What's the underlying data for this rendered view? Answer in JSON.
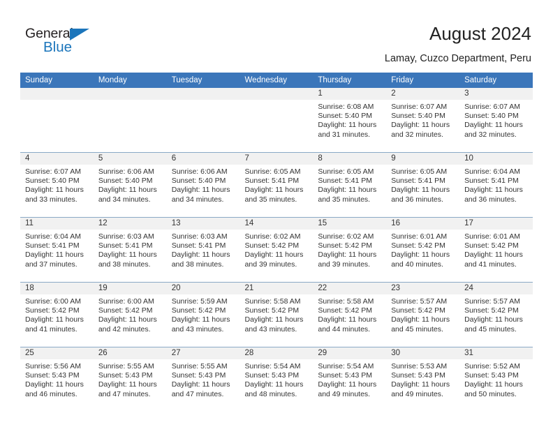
{
  "brand": {
    "name_part1": "General",
    "name_part2": "Blue",
    "triangle_icon": "triangle-icon",
    "color_primary": "#1b75bb",
    "color_text": "#231f20"
  },
  "header": {
    "title": "August 2024",
    "subtitle": "Lamay, Cuzco Department, Peru"
  },
  "theme": {
    "header_bg": "#3b76ba",
    "header_text": "#ffffff",
    "daynum_band_bg": "#f1f1f1",
    "row_divider": "#8aa9c6"
  },
  "weekday_headers": [
    "Sunday",
    "Monday",
    "Tuesday",
    "Wednesday",
    "Thursday",
    "Friday",
    "Saturday"
  ],
  "weeks": [
    [
      {
        "day": "",
        "sunrise": "",
        "sunset": "",
        "daylight1": "",
        "daylight2": ""
      },
      {
        "day": "",
        "sunrise": "",
        "sunset": "",
        "daylight1": "",
        "daylight2": ""
      },
      {
        "day": "",
        "sunrise": "",
        "sunset": "",
        "daylight1": "",
        "daylight2": ""
      },
      {
        "day": "",
        "sunrise": "",
        "sunset": "",
        "daylight1": "",
        "daylight2": ""
      },
      {
        "day": "1",
        "sunrise": "Sunrise: 6:08 AM",
        "sunset": "Sunset: 5:40 PM",
        "daylight1": "Daylight: 11 hours",
        "daylight2": "and 31 minutes."
      },
      {
        "day": "2",
        "sunrise": "Sunrise: 6:07 AM",
        "sunset": "Sunset: 5:40 PM",
        "daylight1": "Daylight: 11 hours",
        "daylight2": "and 32 minutes."
      },
      {
        "day": "3",
        "sunrise": "Sunrise: 6:07 AM",
        "sunset": "Sunset: 5:40 PM",
        "daylight1": "Daylight: 11 hours",
        "daylight2": "and 32 minutes."
      }
    ],
    [
      {
        "day": "4",
        "sunrise": "Sunrise: 6:07 AM",
        "sunset": "Sunset: 5:40 PM",
        "daylight1": "Daylight: 11 hours",
        "daylight2": "and 33 minutes."
      },
      {
        "day": "5",
        "sunrise": "Sunrise: 6:06 AM",
        "sunset": "Sunset: 5:40 PM",
        "daylight1": "Daylight: 11 hours",
        "daylight2": "and 34 minutes."
      },
      {
        "day": "6",
        "sunrise": "Sunrise: 6:06 AM",
        "sunset": "Sunset: 5:40 PM",
        "daylight1": "Daylight: 11 hours",
        "daylight2": "and 34 minutes."
      },
      {
        "day": "7",
        "sunrise": "Sunrise: 6:05 AM",
        "sunset": "Sunset: 5:41 PM",
        "daylight1": "Daylight: 11 hours",
        "daylight2": "and 35 minutes."
      },
      {
        "day": "8",
        "sunrise": "Sunrise: 6:05 AM",
        "sunset": "Sunset: 5:41 PM",
        "daylight1": "Daylight: 11 hours",
        "daylight2": "and 35 minutes."
      },
      {
        "day": "9",
        "sunrise": "Sunrise: 6:05 AM",
        "sunset": "Sunset: 5:41 PM",
        "daylight1": "Daylight: 11 hours",
        "daylight2": "and 36 minutes."
      },
      {
        "day": "10",
        "sunrise": "Sunrise: 6:04 AM",
        "sunset": "Sunset: 5:41 PM",
        "daylight1": "Daylight: 11 hours",
        "daylight2": "and 36 minutes."
      }
    ],
    [
      {
        "day": "11",
        "sunrise": "Sunrise: 6:04 AM",
        "sunset": "Sunset: 5:41 PM",
        "daylight1": "Daylight: 11 hours",
        "daylight2": "and 37 minutes."
      },
      {
        "day": "12",
        "sunrise": "Sunrise: 6:03 AM",
        "sunset": "Sunset: 5:41 PM",
        "daylight1": "Daylight: 11 hours",
        "daylight2": "and 38 minutes."
      },
      {
        "day": "13",
        "sunrise": "Sunrise: 6:03 AM",
        "sunset": "Sunset: 5:41 PM",
        "daylight1": "Daylight: 11 hours",
        "daylight2": "and 38 minutes."
      },
      {
        "day": "14",
        "sunrise": "Sunrise: 6:02 AM",
        "sunset": "Sunset: 5:42 PM",
        "daylight1": "Daylight: 11 hours",
        "daylight2": "and 39 minutes."
      },
      {
        "day": "15",
        "sunrise": "Sunrise: 6:02 AM",
        "sunset": "Sunset: 5:42 PM",
        "daylight1": "Daylight: 11 hours",
        "daylight2": "and 39 minutes."
      },
      {
        "day": "16",
        "sunrise": "Sunrise: 6:01 AM",
        "sunset": "Sunset: 5:42 PM",
        "daylight1": "Daylight: 11 hours",
        "daylight2": "and 40 minutes."
      },
      {
        "day": "17",
        "sunrise": "Sunrise: 6:01 AM",
        "sunset": "Sunset: 5:42 PM",
        "daylight1": "Daylight: 11 hours",
        "daylight2": "and 41 minutes."
      }
    ],
    [
      {
        "day": "18",
        "sunrise": "Sunrise: 6:00 AM",
        "sunset": "Sunset: 5:42 PM",
        "daylight1": "Daylight: 11 hours",
        "daylight2": "and 41 minutes."
      },
      {
        "day": "19",
        "sunrise": "Sunrise: 6:00 AM",
        "sunset": "Sunset: 5:42 PM",
        "daylight1": "Daylight: 11 hours",
        "daylight2": "and 42 minutes."
      },
      {
        "day": "20",
        "sunrise": "Sunrise: 5:59 AM",
        "sunset": "Sunset: 5:42 PM",
        "daylight1": "Daylight: 11 hours",
        "daylight2": "and 43 minutes."
      },
      {
        "day": "21",
        "sunrise": "Sunrise: 5:58 AM",
        "sunset": "Sunset: 5:42 PM",
        "daylight1": "Daylight: 11 hours",
        "daylight2": "and 43 minutes."
      },
      {
        "day": "22",
        "sunrise": "Sunrise: 5:58 AM",
        "sunset": "Sunset: 5:42 PM",
        "daylight1": "Daylight: 11 hours",
        "daylight2": "and 44 minutes."
      },
      {
        "day": "23",
        "sunrise": "Sunrise: 5:57 AM",
        "sunset": "Sunset: 5:42 PM",
        "daylight1": "Daylight: 11 hours",
        "daylight2": "and 45 minutes."
      },
      {
        "day": "24",
        "sunrise": "Sunrise: 5:57 AM",
        "sunset": "Sunset: 5:42 PM",
        "daylight1": "Daylight: 11 hours",
        "daylight2": "and 45 minutes."
      }
    ],
    [
      {
        "day": "25",
        "sunrise": "Sunrise: 5:56 AM",
        "sunset": "Sunset: 5:43 PM",
        "daylight1": "Daylight: 11 hours",
        "daylight2": "and 46 minutes."
      },
      {
        "day": "26",
        "sunrise": "Sunrise: 5:55 AM",
        "sunset": "Sunset: 5:43 PM",
        "daylight1": "Daylight: 11 hours",
        "daylight2": "and 47 minutes."
      },
      {
        "day": "27",
        "sunrise": "Sunrise: 5:55 AM",
        "sunset": "Sunset: 5:43 PM",
        "daylight1": "Daylight: 11 hours",
        "daylight2": "and 47 minutes."
      },
      {
        "day": "28",
        "sunrise": "Sunrise: 5:54 AM",
        "sunset": "Sunset: 5:43 PM",
        "daylight1": "Daylight: 11 hours",
        "daylight2": "and 48 minutes."
      },
      {
        "day": "29",
        "sunrise": "Sunrise: 5:54 AM",
        "sunset": "Sunset: 5:43 PM",
        "daylight1": "Daylight: 11 hours",
        "daylight2": "and 49 minutes."
      },
      {
        "day": "30",
        "sunrise": "Sunrise: 5:53 AM",
        "sunset": "Sunset: 5:43 PM",
        "daylight1": "Daylight: 11 hours",
        "daylight2": "and 49 minutes."
      },
      {
        "day": "31",
        "sunrise": "Sunrise: 5:52 AM",
        "sunset": "Sunset: 5:43 PM",
        "daylight1": "Daylight: 11 hours",
        "daylight2": "and 50 minutes."
      }
    ]
  ]
}
